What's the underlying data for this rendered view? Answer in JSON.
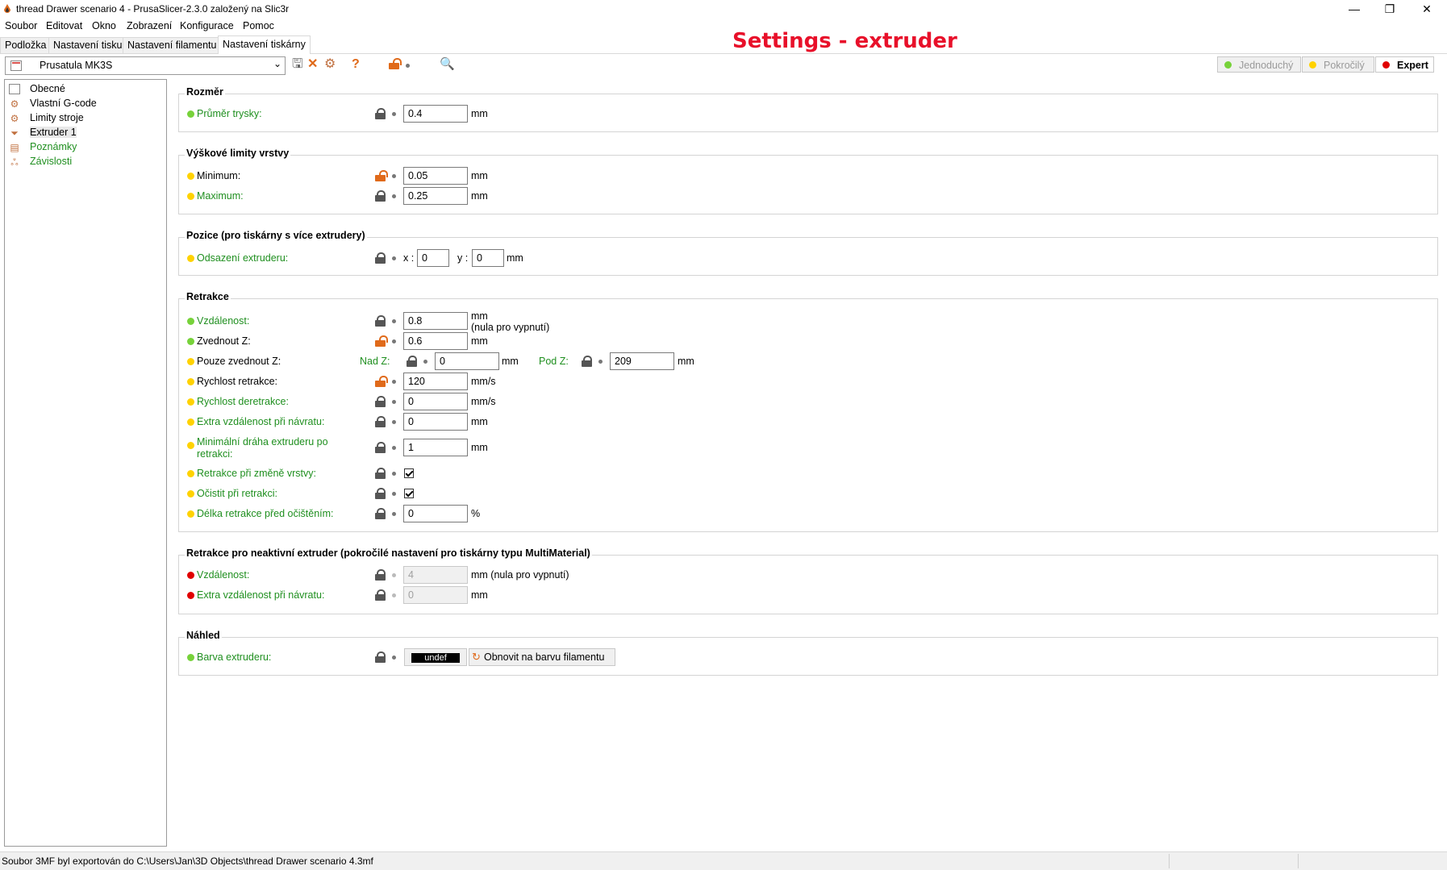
{
  "window": {
    "title": "thread Drawer scenario 4 - PrusaSlicer-2.3.0 založený na Slic3r",
    "minimize": "—",
    "maximize": "❐",
    "close": "✕"
  },
  "menu": [
    "Soubor",
    "Editovat",
    "Okno",
    "Zobrazení",
    "Konfigurace",
    "Pomoc"
  ],
  "tabs": [
    "Podložka",
    "Nastavení tisku",
    "Nastavení filamentu",
    "Nastavení tiskárny"
  ],
  "heading": "Settings - extruder",
  "preset": {
    "name": "Prusatula MK3S"
  },
  "modes": {
    "simple": "Jednoduchý",
    "advanced": "Pokročilý",
    "expert": "Expert"
  },
  "tree": [
    "Obecné",
    "Vlastní G-code",
    "Limity stroje",
    "Extruder 1",
    "Poznámky",
    "Závislosti"
  ],
  "groups": {
    "rozmer": {
      "title": "Rozměr",
      "nozzle": {
        "label": "Průměr trysky:",
        "value": "0.4",
        "unit": "mm"
      }
    },
    "vyska": {
      "title": "Výškové limity vrstvy",
      "min": {
        "label": "Minimum:",
        "value": "0.05",
        "unit": "mm"
      },
      "max": {
        "label": "Maximum:",
        "value": "0.25",
        "unit": "mm"
      }
    },
    "pozice": {
      "title": "Pozice (pro tiskárny s více extrudery)",
      "offset": {
        "label": "Odsazení extruderu:",
        "xlabel": "x :",
        "x": "0",
        "ylabel": "y :",
        "y": "0",
        "unit": "mm"
      }
    },
    "retrakce": {
      "title": "Retrakce",
      "length": {
        "label": "Vzdálenost:",
        "value": "0.8",
        "unit": "mm",
        "note": "(nula pro vypnutí)"
      },
      "lift": {
        "label": "Zvednout Z:",
        "value": "0.6",
        "unit": "mm"
      },
      "only_lift": {
        "label": "Pouze zvednout Z:",
        "above_label": "Nad Z:",
        "above": "0",
        "above_unit": "mm",
        "below_label": "Pod Z:",
        "below": "209",
        "below_unit": "mm"
      },
      "speed": {
        "label": "Rychlost retrakce:",
        "value": "120",
        "unit": "mm/s"
      },
      "deretract": {
        "label": "Rychlost deretrakce:",
        "value": "0",
        "unit": "mm/s"
      },
      "restart_extra": {
        "label": "Extra vzdálenost při návratu:",
        "value": "0",
        "unit": "mm"
      },
      "min_travel": {
        "label": "Minimální dráha extruderu po retrakci:",
        "value": "1",
        "unit": "mm"
      },
      "layer_change": {
        "label": "Retrakce při změně vrstvy:",
        "checked": true
      },
      "wipe": {
        "label": "Očistit při retrakci:",
        "checked": true
      },
      "before_wipe": {
        "label": "Délka retrakce před očištěním:",
        "value": "0",
        "unit": "%"
      }
    },
    "toolchange": {
      "title": "Retrakce pro neaktivní extruder (pokročilé nastavení pro tiskárny typu MultiMaterial)",
      "length": {
        "label": "Vzdálenost:",
        "value": "4",
        "unit": "mm (nula pro vypnutí)"
      },
      "extra": {
        "label": "Extra vzdálenost při návratu:",
        "value": "0",
        "unit": "mm"
      }
    },
    "nahled": {
      "title": "Náhled",
      "color": {
        "label": "Barva extruderu:",
        "swatch": "undef",
        "reset": "Obnovit na barvu filamentu"
      }
    }
  },
  "status": "Soubor 3MF byl exportován do C:\\Users\\Jan\\3D Objects\\thread Drawer scenario 4.3mf",
  "colors": {
    "heading": "#e8102a",
    "label_green": "#1f8f1f",
    "unlocked": "#e06a1a"
  }
}
